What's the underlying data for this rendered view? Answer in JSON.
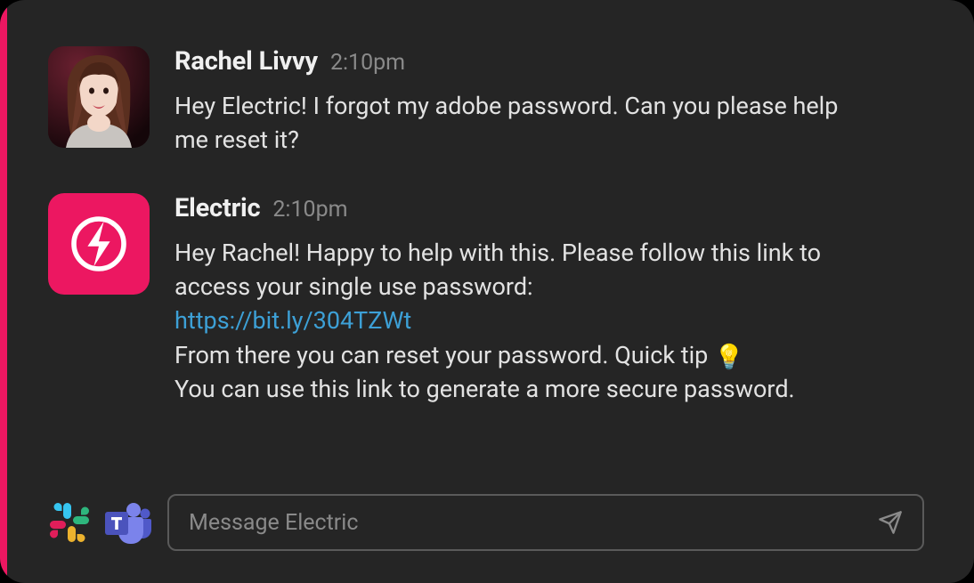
{
  "messages": [
    {
      "name": "Rachel Livvy",
      "time": "2:10pm",
      "text": "Hey Electric! I forgot my adobe password. Can you please help me reset it?"
    },
    {
      "name": "Electric",
      "time": "2:10pm",
      "text_before_link": "Hey Rachel! Happy to help with this. Please follow this link to access your single use password:",
      "link": "https://bit.ly/304TZWt",
      "text_after_link_1": "From there you can reset your password. Quick tip",
      "bulb": "💡",
      "text_after_link_2": "You can use this link to generate a more secure password."
    }
  ],
  "composer": {
    "placeholder": "Message Electric"
  },
  "colors": {
    "accent": "#ec1761",
    "link": "#3da0d6"
  }
}
